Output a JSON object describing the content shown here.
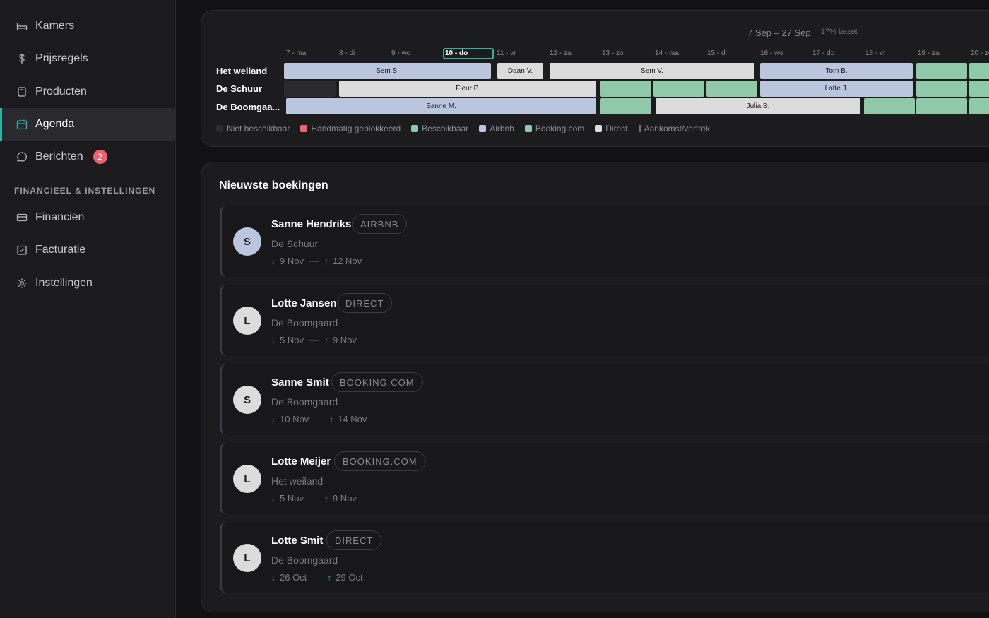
{
  "sidebar": {
    "items": [
      {
        "label": "Kamers",
        "icon": "bed-icon"
      },
      {
        "label": "Prijsregels",
        "icon": "dollar-icon"
      },
      {
        "label": "Producten",
        "icon": "product-icon"
      },
      {
        "label": "Agenda",
        "icon": "calendar-icon",
        "active": true
      },
      {
        "label": "Berichten",
        "icon": "chat-icon",
        "badge": "2"
      }
    ],
    "section_label": "FINANCIEEL & INSTELLINGEN",
    "items2": [
      {
        "label": "Financiën",
        "icon": "card-icon"
      },
      {
        "label": "Facturatie",
        "icon": "invoice-icon"
      },
      {
        "label": "Instellingen",
        "icon": "gear-icon"
      }
    ]
  },
  "calendar": {
    "range": "7 Sep – 27 Sep",
    "occupancy": "· 17% bezet",
    "days": [
      "7 - ma",
      "8 - di",
      "9 - wo",
      "10 - do",
      "11 - vr",
      "12 - za",
      "13 - zo",
      "14 - ma",
      "15 - di",
      "16 - wo",
      "17 - do",
      "18 - vr",
      "19 - za",
      "20 - zo"
    ],
    "today_index": 3,
    "rooms": [
      "Het weiland",
      "De Schuur",
      "De Boomgaa..."
    ],
    "bookings": {
      "b1": "Sem S.",
      "b2": "Daan V.",
      "b3": "Sem V.",
      "b4": "Tom B.",
      "b5": "Fleur P.",
      "b6": "Lotte J.",
      "b7": "Sanne M.",
      "b8": "Julia B."
    },
    "legend": [
      "Niet beschikbaar",
      "Handmatig geblokkeerd",
      "Beschikbaar",
      "Airbnb",
      "Booking.com",
      "Direct",
      "Aankomst/vertrek"
    ],
    "colors": {
      "airbnb": "#b9c6dd",
      "direct": "#dcdcdc",
      "available": "#8fc9a7",
      "blocked": "#f0616d",
      "unavailable": "#2a2a2f",
      "accent": "#2bb3a3"
    }
  },
  "bookings_list": {
    "title": "Nieuwste boekingen",
    "items": [
      {
        "initial": "S",
        "name": "Sanne Hendriks",
        "source": "AIRBNB",
        "room": "De Schuur",
        "checkin": "9 Nov",
        "checkout": "12 Nov"
      },
      {
        "initial": "L",
        "name": "Lotte Jansen",
        "source": "DIRECT",
        "room": "De Boomgaard",
        "checkin": "5 Nov",
        "checkout": "9 Nov"
      },
      {
        "initial": "S",
        "name": "Sanne Smit",
        "source": "BOOKING.COM",
        "room": "De Boomgaard",
        "checkin": "10 Nov",
        "checkout": "14 Nov"
      },
      {
        "initial": "L",
        "name": "Lotte Meijer",
        "source": "BOOKING.COM",
        "room": "Het weiland",
        "checkin": "5 Nov",
        "checkout": "9 Nov"
      },
      {
        "initial": "L",
        "name": "Lotte Smit",
        "source": "DIRECT",
        "room": "De Boomgaard",
        "checkin": "26 Oct",
        "checkout": "29 Oct"
      }
    ]
  }
}
